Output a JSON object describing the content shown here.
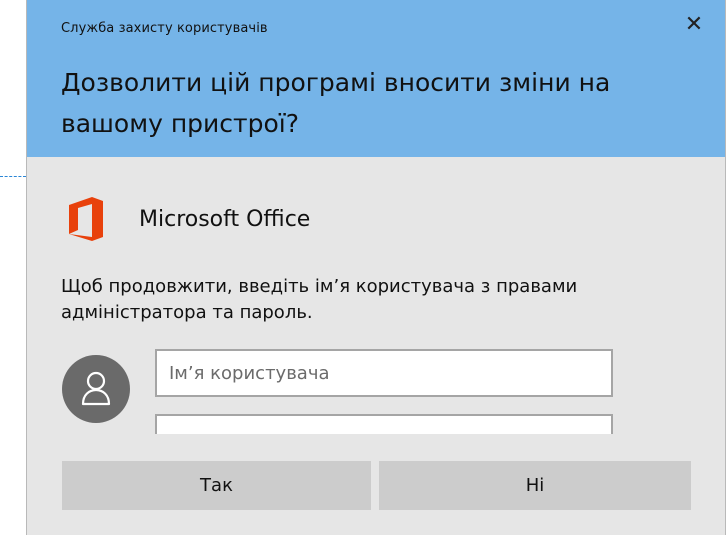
{
  "dialog": {
    "service_title": "Служба захисту користувачів",
    "close_symbol": "✕",
    "question": "Дозволити цій програмі вносити зміни на вашому пристрої?",
    "app": {
      "icon": "office-icon",
      "name": "Microsoft Office",
      "icon_color": "#e8410c"
    },
    "prompt": "Щоб продовжити, введіть ім’я користувача з правами адміністратора та пароль.",
    "username": {
      "placeholder": "Ім’я користувача",
      "value": ""
    },
    "password": {
      "value": ""
    },
    "buttons": {
      "yes_label": "Так",
      "no_label": "Ні"
    }
  },
  "colors": {
    "header_bg": "#75b4e8",
    "body_bg": "#e6e6e6",
    "button_bg": "#cccccc",
    "avatar_bg": "#6a6a6a"
  }
}
